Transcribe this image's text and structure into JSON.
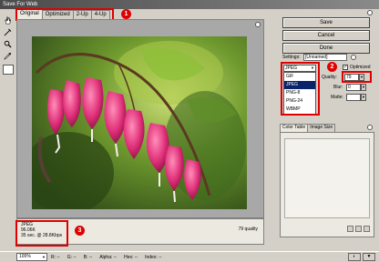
{
  "window": {
    "title": "Save For Web"
  },
  "tabs": [
    {
      "label": "Original"
    },
    {
      "label": "Optimized"
    },
    {
      "label": "2-Up"
    },
    {
      "label": "4-Up"
    }
  ],
  "callouts": [
    "1",
    "2",
    "3"
  ],
  "buttons": {
    "save": "Save",
    "cancel": "Cancel",
    "done": "Done"
  },
  "settings": {
    "label": "Settings:",
    "value": "[Unnamed]",
    "format_value": "JPEG",
    "format_options": [
      "GIF",
      "JPEG",
      "PNG-8",
      "PNG-24",
      "WBMP"
    ],
    "selected_format": "JPEG",
    "optimized_label": "Optimized",
    "optimized_checked": true,
    "quality_label": "Quality:",
    "quality_value": "79",
    "blur_label": "Blur:",
    "blur_value": "0",
    "matte_label": "Matte:",
    "matte_value": ""
  },
  "panel_tabs": {
    "color_table": "Color Table",
    "image_size": "Image Size"
  },
  "info": {
    "format": "JPEG",
    "size": "96.06K",
    "time": "35 sec. @ 28.8Kbps",
    "quality": "79 quality"
  },
  "status": {
    "zoom": "100%",
    "r": "R: --",
    "g": "G: --",
    "b": "B: --",
    "alpha": "Alpha: --",
    "hex": "Hex: --",
    "index": "Index: --"
  },
  "colors": {
    "callout": "#e00000",
    "selection": "#0a246a",
    "flower": "#e0307a"
  }
}
